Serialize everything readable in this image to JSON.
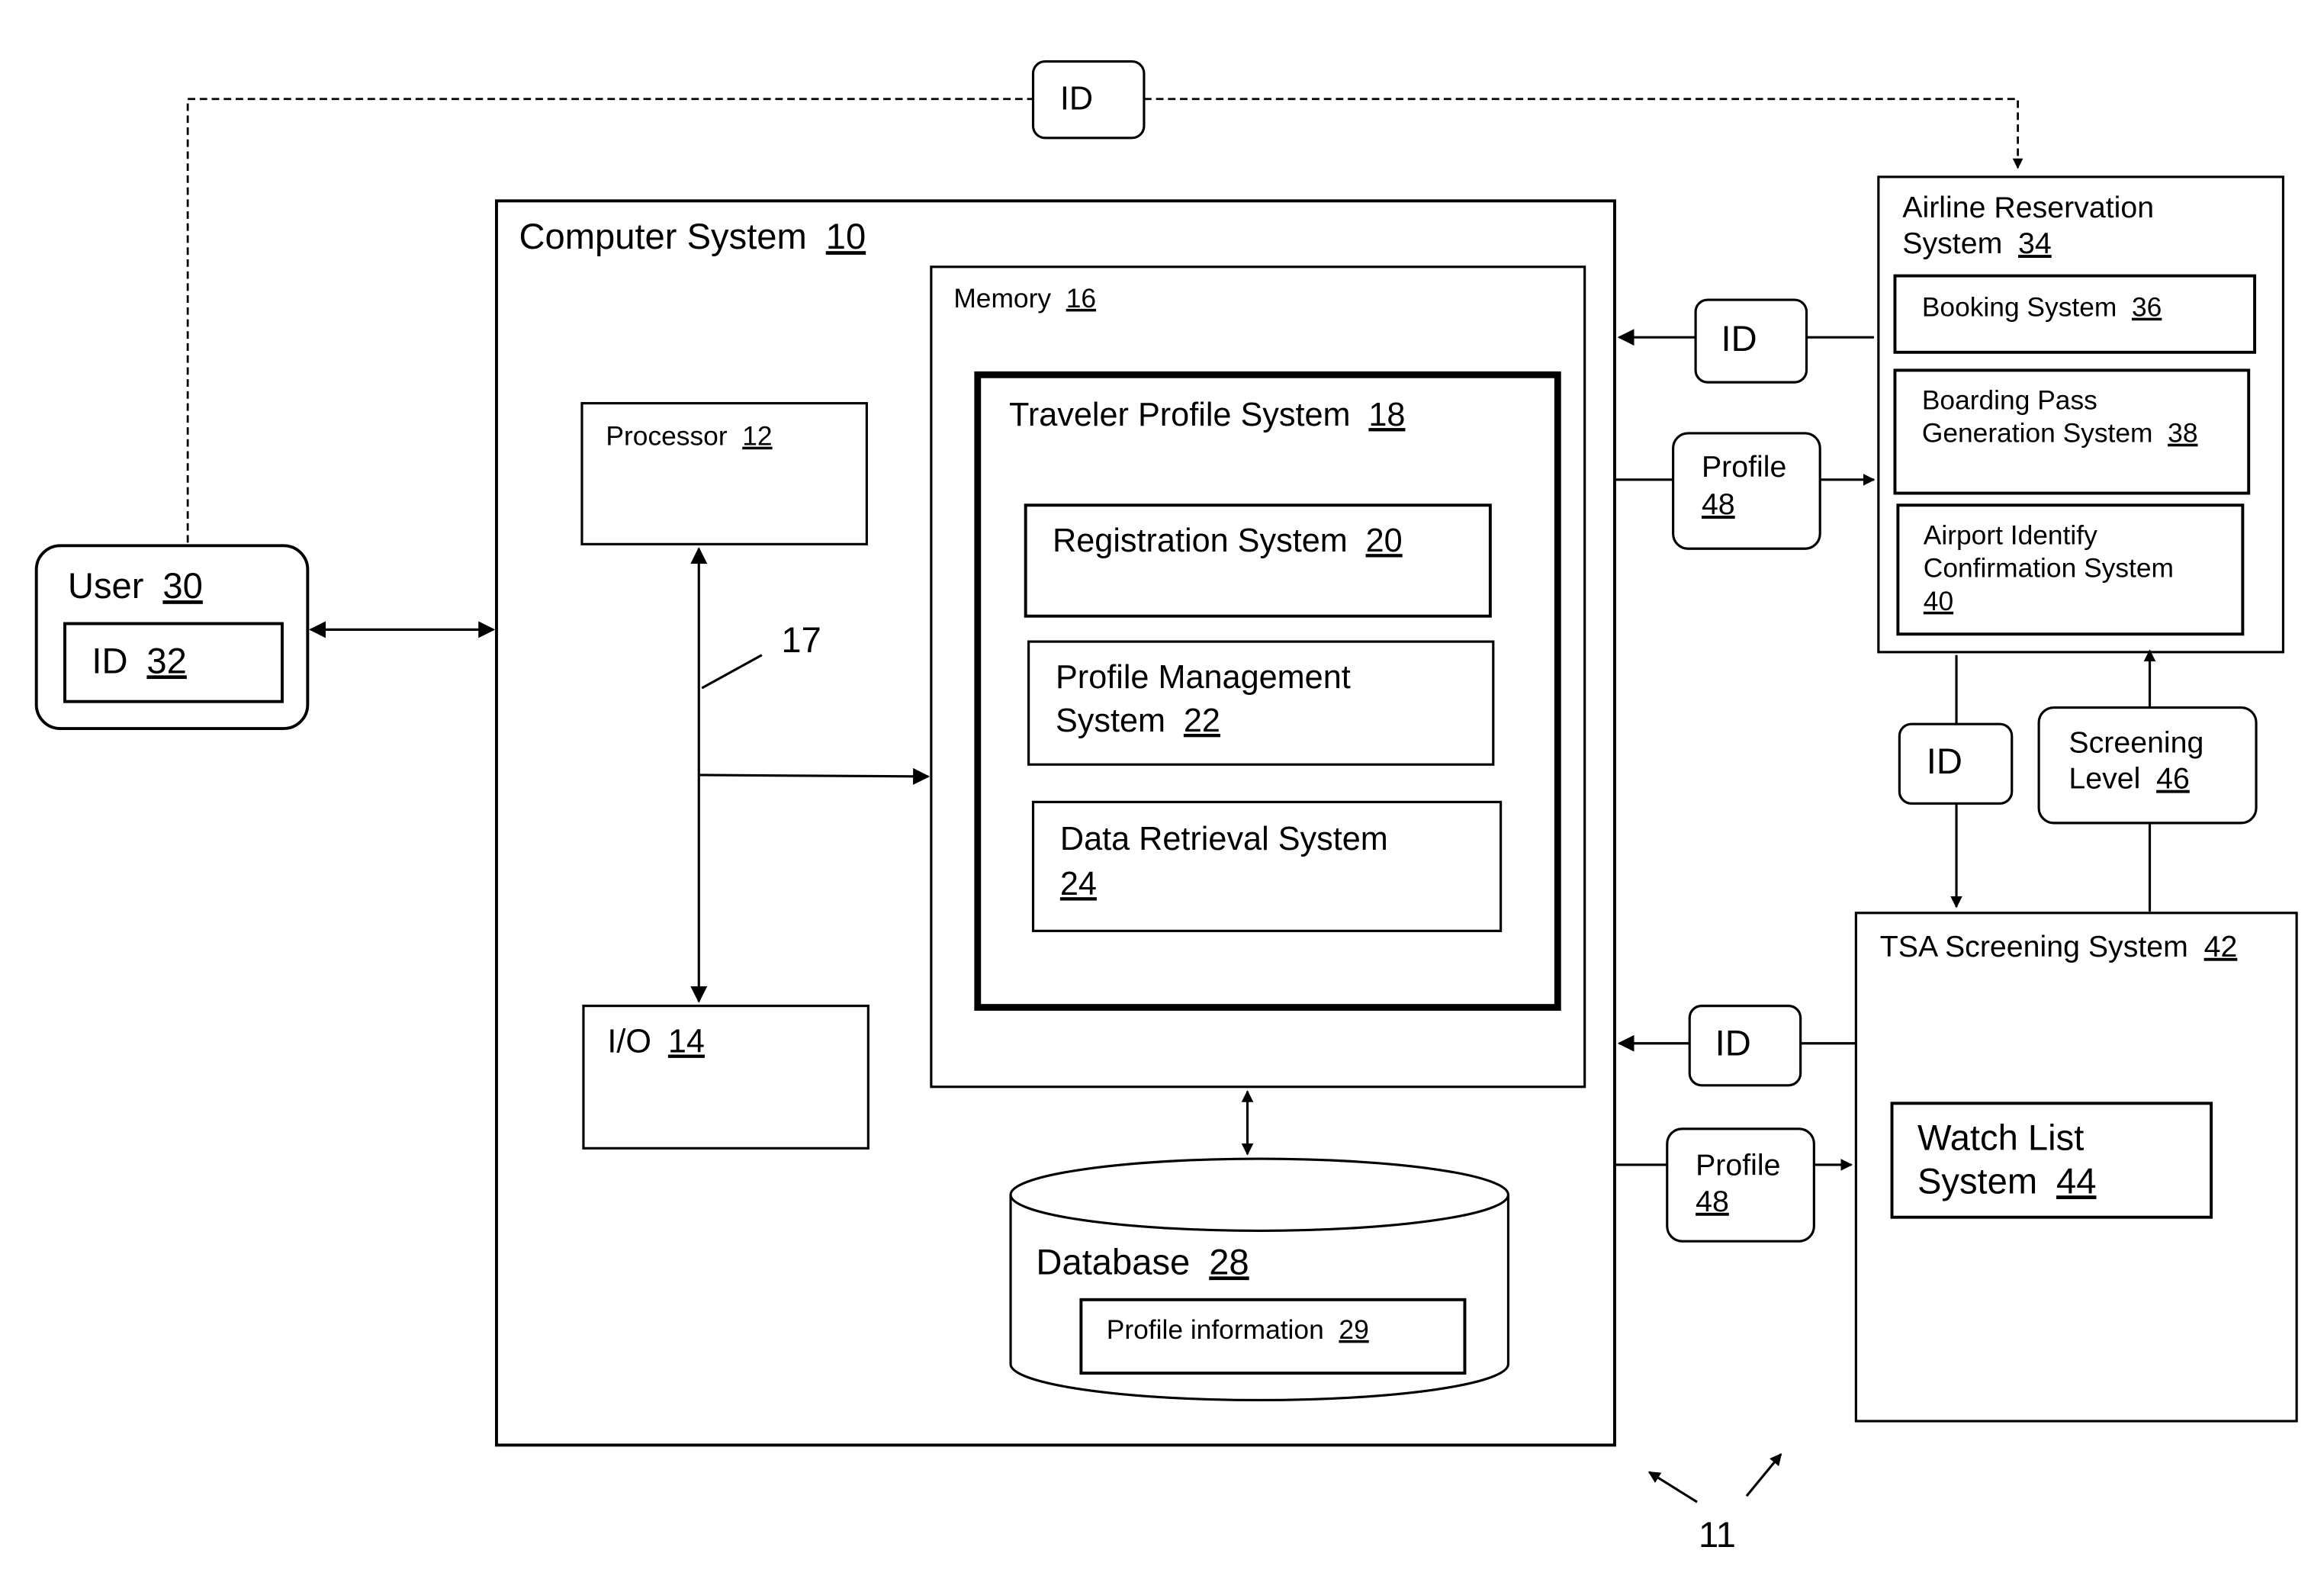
{
  "diagram": {
    "reference_numeral_overall": "11",
    "bus_label": "17",
    "user": {
      "name": "User",
      "ref": "30",
      "id_name": "ID",
      "id_ref": "32"
    },
    "top_id_token": "ID",
    "computer_system": {
      "name": "Computer System",
      "ref": "10"
    },
    "processor": {
      "name": "Processor",
      "ref": "12"
    },
    "io": {
      "name": "I/O",
      "ref": "14"
    },
    "memory": {
      "name": "Memory",
      "ref": "16"
    },
    "traveler_profile_system": {
      "name": "Traveler Profile System",
      "ref": "18"
    },
    "registration_system": {
      "name": "Registration System",
      "ref": "20"
    },
    "profile_management_system": {
      "line1": "Profile Management",
      "line2": "System",
      "ref": "22"
    },
    "data_retrieval_system": {
      "line1": "Data Retrieval System",
      "ref": "24"
    },
    "database": {
      "name": "Database",
      "ref": "28"
    },
    "profile_information": {
      "name": "Profile information",
      "ref": "29"
    },
    "airline_reservation_system": {
      "line1": "Airline Reservation",
      "line2": "System",
      "ref": "34"
    },
    "booking_system": {
      "name": "Booking System",
      "ref": "36"
    },
    "boarding_pass_system": {
      "line1": "Boarding Pass",
      "line2": "Generation System",
      "ref": "38"
    },
    "airport_identify_system": {
      "line1": "Airport Identify",
      "line2": "Confirmation System",
      "ref": "40"
    },
    "tsa_screening_system": {
      "name": "TSA Screening System",
      "ref": "42"
    },
    "watch_list_system": {
      "line1": "Watch List",
      "line2": "System",
      "ref": "44"
    },
    "screening_level": {
      "line1": "Screening",
      "line2": "Level",
      "ref": "46"
    },
    "tokens": {
      "id_from_airline": "ID",
      "profile_to_airline": {
        "name": "Profile",
        "ref": "48"
      },
      "id_airline_to_tsa": "ID",
      "id_from_tsa": "ID",
      "profile_to_tsa": {
        "name": "Profile",
        "ref": "48"
      }
    }
  }
}
